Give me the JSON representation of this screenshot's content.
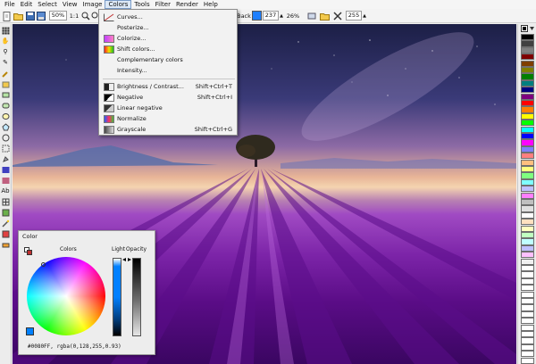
{
  "menubar": {
    "items": [
      "File",
      "Edit",
      "Select",
      "View",
      "Image",
      "Colors",
      "Tools",
      "Filter",
      "Render",
      "Help"
    ],
    "active": "Colors"
  },
  "toolbar": {
    "zoom": "50%",
    "ratio": "1:1",
    "back_label": "Back",
    "back_value": "237",
    "percent": "26%",
    "alpha": "255",
    "back_color": "#1e7fff"
  },
  "colors_menu": {
    "items": [
      {
        "label": "Curves...",
        "shortcut": ""
      },
      {
        "label": "Posterize...",
        "shortcut": ""
      },
      {
        "label": "Colorize...",
        "shortcut": ""
      },
      {
        "label": "Shift colors...",
        "shortcut": ""
      },
      {
        "label": "Complementary colors",
        "shortcut": ""
      },
      {
        "label": "Intensity...",
        "shortcut": ""
      },
      {
        "label": "Brightness / Contrast...",
        "shortcut": "Shift+Ctrl+T"
      },
      {
        "label": "Negative",
        "shortcut": "Shift+Ctrl+I"
      },
      {
        "label": "Linear negative",
        "shortcut": ""
      },
      {
        "label": "Normalize",
        "shortcut": ""
      },
      {
        "label": "Grayscale",
        "shortcut": "Shift+Ctrl+G"
      }
    ]
  },
  "color_window": {
    "title": "Color",
    "colors_label": "Colors",
    "light_label": "Light",
    "opacity_label": "Opacity",
    "value_text": "#0080FF, rgba(0,128,255,0.93)"
  },
  "palette": {
    "colors": [
      "#000000",
      "#404040",
      "#808080",
      "#7f0000",
      "#7f3f00",
      "#7f7f00",
      "#007f00",
      "#007f7f",
      "#00007f",
      "#7f007f",
      "#ff0000",
      "#ff7f00",
      "#ffff00",
      "#00ff00",
      "#00ffff",
      "#0000ff",
      "#ff00ff",
      "#7f7fff",
      "#ff7f7f",
      "#ffbf7f",
      "#ffff7f",
      "#7fff7f",
      "#7fffff",
      "#bfbfff",
      "#ff7fff",
      "#c0c0c0",
      "#e0e0e0",
      "#ffffff",
      "#ffe0c0",
      "#ffffc0",
      "#c0ffc0",
      "#c0ffff",
      "#c0c0ff",
      "#ffc0ff",
      "#f0f0f0",
      "#ffffff",
      "#ffffff",
      "#ffffff",
      "#ffffff",
      "#ffffff",
      "#ffffff",
      "#ffffff",
      "#ffffff",
      "#ffffff",
      "#ffffff",
      "#ffffff",
      "#ffffff",
      "#ffffff",
      "#ffffff",
      "#ffffff"
    ]
  }
}
